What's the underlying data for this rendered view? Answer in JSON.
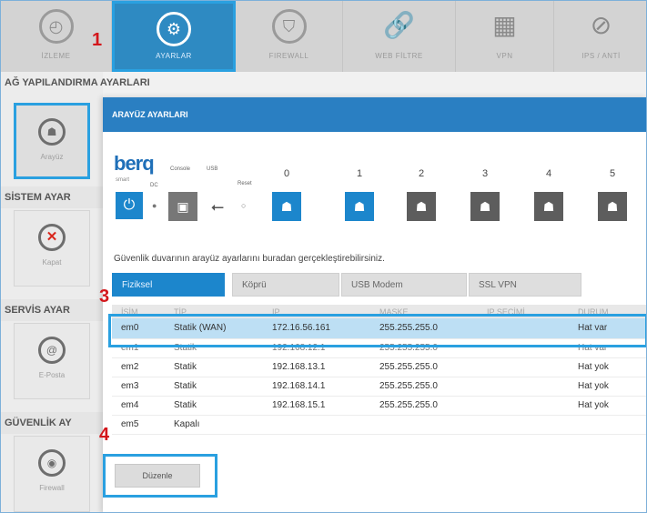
{
  "nav": {
    "tabs": [
      {
        "label": "İZLEME",
        "icon": "gauge-icon"
      },
      {
        "label": "AYARLAR",
        "icon": "gear-icon"
      },
      {
        "label": "FIREWALL",
        "icon": "shield-icon"
      },
      {
        "label": "WEB FİLTRE",
        "icon": "link-icon"
      },
      {
        "label": "VPN",
        "icon": "network-icon"
      },
      {
        "label": "IPS / ANTİ",
        "icon": "ips-icon"
      }
    ],
    "active_index": 1
  },
  "markers": [
    "1",
    "3",
    "4"
  ],
  "page_heading": "AĞ YAPILANDIRMA AYARLARI",
  "sidebar": {
    "sections": [
      {
        "heading": "",
        "item": {
          "label": "Arayüz",
          "icon": "network-port-icon"
        }
      },
      {
        "heading": "SİSTEM AYAR",
        "item": {
          "label": "Kapat",
          "icon": "close-icon"
        }
      },
      {
        "heading": "SERVİS AYAR",
        "item": {
          "label": "E-Posta",
          "icon": "email-icon"
        }
      },
      {
        "heading": "GÜVENLİK AY",
        "item": {
          "label": "Firewall",
          "icon": "firewall-icon"
        }
      }
    ]
  },
  "panel": {
    "title": "ARAYÜZ AYARLARI",
    "device": {
      "brand": "berq",
      "brand_sub": "smart",
      "labels": {
        "console": "Console",
        "usb": "USB",
        "reset": "Reset",
        "dc": "DC"
      },
      "ports": [
        "0",
        "1",
        "2",
        "3",
        "4",
        "5"
      ],
      "active_ports": [
        0,
        1
      ]
    },
    "description": "Güvenlik duvarının arayüz ayarlarını buradan gerçekleştirebilirsiniz.",
    "tabs": [
      "Fiziksel",
      "Köprü",
      "USB Modem",
      "SSL VPN"
    ],
    "active_tab": 0,
    "table": {
      "columns": [
        "İSİM",
        "TİP",
        "IP",
        "MASKE",
        "IP SEÇİMİ",
        "DURUM"
      ],
      "rows": [
        [
          "em0",
          "Statik (WAN)",
          "172.16.56.161",
          "255.255.255.0",
          "",
          "Hat var"
        ],
        [
          "em1",
          "Statik",
          "192.168.12.1",
          "255.255.255.0",
          "",
          "Hat var"
        ],
        [
          "em2",
          "Statik",
          "192.168.13.1",
          "255.255.255.0",
          "",
          "Hat yok"
        ],
        [
          "em3",
          "Statik",
          "192.168.14.1",
          "255.255.255.0",
          "",
          "Hat yok"
        ],
        [
          "em4",
          "Statik",
          "192.168.15.1",
          "255.255.255.0",
          "",
          "Hat yok"
        ],
        [
          "em5",
          "Kapalı",
          "",
          "",
          "",
          ""
        ]
      ],
      "selected_row": 0
    },
    "edit_button": "Düzenle"
  },
  "colors": {
    "accent": "#2a7fc2",
    "highlight": "#2aa0e0",
    "marker": "#d3161b"
  }
}
